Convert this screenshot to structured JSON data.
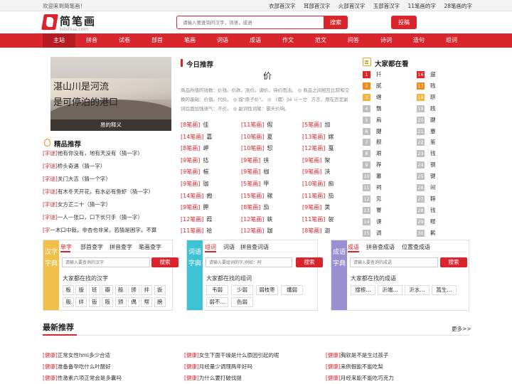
{
  "topbar": {
    "welcome": "欢迎来到简笔画！",
    "links": [
      "衣部首汉字",
      "耳部首汉字",
      "火部首汉字",
      "玉部首汉字",
      "11笔画的字",
      "28笔画的字"
    ]
  },
  "logo": {
    "title": "简笔画",
    "url": "bibihua.com"
  },
  "search": {
    "placeholder": "请输入要查询的汉字，词语，成语",
    "button": "搜索"
  },
  "submit_button": "投稿",
  "nav": [
    "主站",
    "拼音",
    "试卷",
    "部首",
    "笔画",
    "词语",
    "成语",
    "作文",
    "范文",
    "问答",
    "诗词",
    "造句",
    "组词"
  ],
  "hero": {
    "line1": "湛山川是河流",
    "line2": "是可停泊的港口",
    "caption": "易的释义"
  },
  "riddles": {
    "title": "精品推荐",
    "items": [
      {
        "tag": "[字谜]",
        "text": "他有你没有，地有天没有（猜一字）"
      },
      {
        "tag": "[字谜]",
        "text": "桥头奇遇（猜一字）"
      },
      {
        "tag": "[字谜]",
        "text": "关门大吉（猜一个字）"
      },
      {
        "tag": "[字谜]",
        "text": "有木冬天开花，有水必有鱼虾（猜一字）"
      },
      {
        "tag": "[字谜]",
        "text": "女方正二十（猜一字）"
      },
      {
        "tag": "[字谜]",
        "text": "一人一张口，口下长只手（猜一字）"
      },
      {
        "tag": "[字",
        "text": "一木口中栽，非杏也非呆，若猜是困字，不算"
      }
    ]
  },
  "today": {
    "title": "今日推荐",
    "char": "价",
    "desc": "商品所值的钱数：价钱。价款。涨价。调价。待价而沽。 ◎ 商品之间相互比较和交换的基础：价值。代价。 ◎ 指\"原子价\"。 ◎ （價）jiè ㄐㄧㄝˋ 方言，用在否定副词后面加强语气：不价。 ◎ 副词性词尾：震天价响。",
    "words": [
      [
        {
          "s": "[8笔画]",
          "c": "佳"
        },
        {
          "s": "[11笔画]",
          "c": "假"
        },
        {
          "s": "[5笔画]",
          "c": "加"
        }
      ],
      [
        {
          "s": "[14笔画]",
          "c": "嘉"
        },
        {
          "s": "[10笔画]",
          "c": "夏"
        },
        {
          "s": "[13笔画]",
          "c": "嫁"
        }
      ],
      [
        {
          "s": "[8笔画]",
          "c": "岬"
        },
        {
          "s": "[10笔画]",
          "c": "恝"
        },
        {
          "s": "[12笔画]",
          "c": "戛"
        }
      ],
      [
        {
          "s": "[9笔画]",
          "c": "拮"
        },
        {
          "s": "[9笔画]",
          "c": "挟"
        },
        {
          "s": "[9笔画]",
          "c": "架"
        }
      ],
      [
        {
          "s": "[9笔画]",
          "c": "榿"
        },
        {
          "s": "[9笔画]",
          "c": "枷"
        },
        {
          "s": "[9笔画]",
          "c": "浃"
        }
      ],
      [
        {
          "s": "[9笔画]",
          "c": "珈"
        },
        {
          "s": "[5笔画]",
          "c": "甲"
        },
        {
          "s": "[10笔画]",
          "c": "痂"
        }
      ],
      [
        {
          "s": "[14笔画]",
          "c": "瘕"
        },
        {
          "s": "[15笔画]",
          "c": "稼"
        },
        {
          "s": "[11笔画]",
          "c": "茄"
        }
      ],
      [
        {
          "s": "[9笔画]",
          "c": "胛"
        },
        {
          "s": "[8笔画]",
          "c": "茄"
        },
        {
          "s": "[9笔画]",
          "c": "荚"
        }
      ],
      [
        {
          "s": "[12笔画]",
          "c": "葭"
        },
        {
          "s": "[12笔画]",
          "c": "蛱"
        },
        {
          "s": "[11笔画]",
          "c": "袈"
        }
      ],
      [
        {
          "s": "[11笔画]",
          "c": "袷"
        },
        {
          "s": "[12笔画]",
          "c": "跏"
        },
        {
          "s": "[8笔画]",
          "c": "迦"
        }
      ]
    ]
  },
  "hot": {
    "title": "大家都在看",
    "left": [
      {
        "n": "1",
        "c": "扦"
      },
      {
        "n": "2",
        "c": "腻"
      },
      {
        "n": "3",
        "c": "缠"
      },
      {
        "n": "4",
        "c": "翳"
      },
      {
        "n": "5",
        "c": "肩"
      },
      {
        "n": "6",
        "c": "腱"
      },
      {
        "n": "7",
        "c": "舰"
      },
      {
        "n": "8",
        "c": "艰"
      },
      {
        "n": "9",
        "c": "荐"
      },
      {
        "n": "10",
        "c": "蕃"
      },
      {
        "n": "11",
        "c": "祠"
      },
      {
        "n": "12",
        "c": "见"
      },
      {
        "n": "13",
        "c": "謇"
      },
      {
        "n": "14",
        "c": "谏"
      },
      {
        "n": "15",
        "c": "调"
      }
    ],
    "right": [
      {
        "n": "16",
        "c": "遛"
      },
      {
        "n": "17",
        "c": "贱"
      },
      {
        "n": "18",
        "c": "趼"
      },
      {
        "n": "19",
        "c": "践"
      },
      {
        "n": "20",
        "c": "踺"
      },
      {
        "n": "21",
        "c": "蹇"
      },
      {
        "n": "22",
        "c": "鉴"
      },
      {
        "n": "23",
        "c": "钱"
      },
      {
        "n": "24",
        "c": "钢"
      },
      {
        "n": "25",
        "c": "键"
      },
      {
        "n": "26",
        "c": "间"
      },
      {
        "n": "27",
        "c": "鞯"
      },
      {
        "n": "28",
        "c": "钱"
      },
      {
        "n": "29",
        "c": "鲣"
      },
      {
        "n": "30",
        "c": "鹣"
      }
    ],
    "colors": [
      "#d8262c",
      "#f08a1c",
      "#f3b33d",
      "#bfbfbf"
    ]
  },
  "box1": {
    "side": "汉字字典",
    "color": "#f0c04a",
    "tabs": [
      "单字",
      "部首查字",
      "拼音查字",
      "笔画查字"
    ],
    "placeholder": "请输入要查询的汉字",
    "button": "搜索",
    "sub": "大家都在找的汉字",
    "cells": [
      "板",
      "版",
      "班",
      "瓣",
      "般",
      "颁",
      "拌",
      "扳",
      "般",
      "绊",
      "钣",
      "阪",
      "颁",
      "偶",
      "帮",
      "膀"
    ]
  },
  "box2": {
    "side": "词语字典",
    "color": "#3ec3d5",
    "tabs": [
      "组词",
      "词语",
      "拼音查词语"
    ],
    "placeholder": "请输入要组词的字,例如：阿",
    "button": "搜索",
    "sub": "大家都在找的组词",
    "cells": [
      "韦弱",
      "少弱",
      "弱枝枣",
      "孅弱",
      "弱不...",
      "色弱"
    ]
  },
  "box3": {
    "side": "成语字典",
    "color": "#9b8fd3",
    "tabs": [
      "成语",
      "拼音查成语",
      "位置查成语"
    ],
    "placeholder": "请输入要查询的成语",
    "button": "搜索",
    "sub": "大家都在找的成语",
    "cells": [
      "搜根...",
      "沂端...",
      "沂水...",
      "篙生..."
    ]
  },
  "latest": {
    "title": "最新推荐",
    "more": "更多>>",
    "items": [
      {
        "tag": "[健康]",
        "text": "正常女性hmi多少合适"
      },
      {
        "tag": "[健康]",
        "text": "女生下面干燥是什么原因引起的呢"
      },
      {
        "tag": "[健康]",
        "text": "胸软是不是生过孩子"
      },
      {
        "tag": "[健康]",
        "text": "准备备孕吃什么叶酸好"
      },
      {
        "tag": "[健康]",
        "text": "月经量少调理两年好吗"
      },
      {
        "tag": "[健康]",
        "text": "来例假能不能吃梨"
      },
      {
        "tag": "[健康]",
        "text": "性激素六项正常会是多囊吗"
      },
      {
        "tag": "[健康]",
        "text": "为什么要打破伐提"
      },
      {
        "tag": "[健康]",
        "text": "月经来能不能吃巧克力"
      }
    ]
  }
}
